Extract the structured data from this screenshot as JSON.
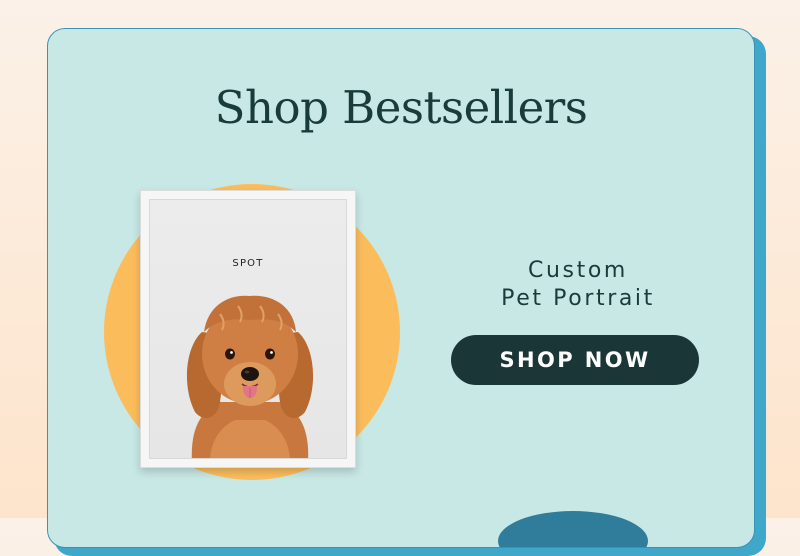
{
  "section": {
    "title": "Shop Bestsellers"
  },
  "product": {
    "frame_name": "SPOT",
    "name_line1": "Custom",
    "name_line2": "Pet Portrait",
    "cta_label": "SHOP NOW"
  },
  "colors": {
    "card_bg": "#c8e8e5",
    "card_border": "#3b93b3",
    "accent_circle": "#fbbd5c",
    "button_bg": "#1b3636",
    "title_text": "#183c3a"
  }
}
